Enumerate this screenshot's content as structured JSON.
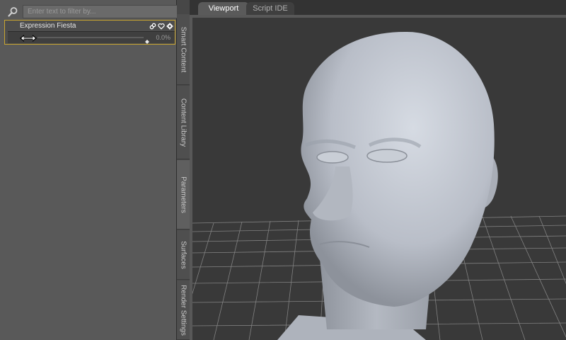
{
  "search": {
    "placeholder": "Enter text to filter by..."
  },
  "parameter": {
    "name": "Expression Fiesta",
    "value": "0.0%",
    "level": 0.0
  },
  "side_tabs": [
    {
      "label": "Smart Content"
    },
    {
      "label": "Content Library"
    },
    {
      "label": "Parameters"
    },
    {
      "label": "Surfaces"
    },
    {
      "label": "Render Settings"
    }
  ],
  "top_tabs": [
    {
      "label": "Viewport"
    },
    {
      "label": "Script IDE"
    }
  ],
  "colors": {
    "accent_border": "#c9a530",
    "panel_bg": "#595959",
    "viewport_bg": "#3a3a3a"
  },
  "icons": {
    "search": "search-icon",
    "link": "link-icon",
    "favorite": "heart-icon",
    "settings": "gear-icon",
    "menu": "menu-icon",
    "drag": "drag-arrows-icon"
  }
}
